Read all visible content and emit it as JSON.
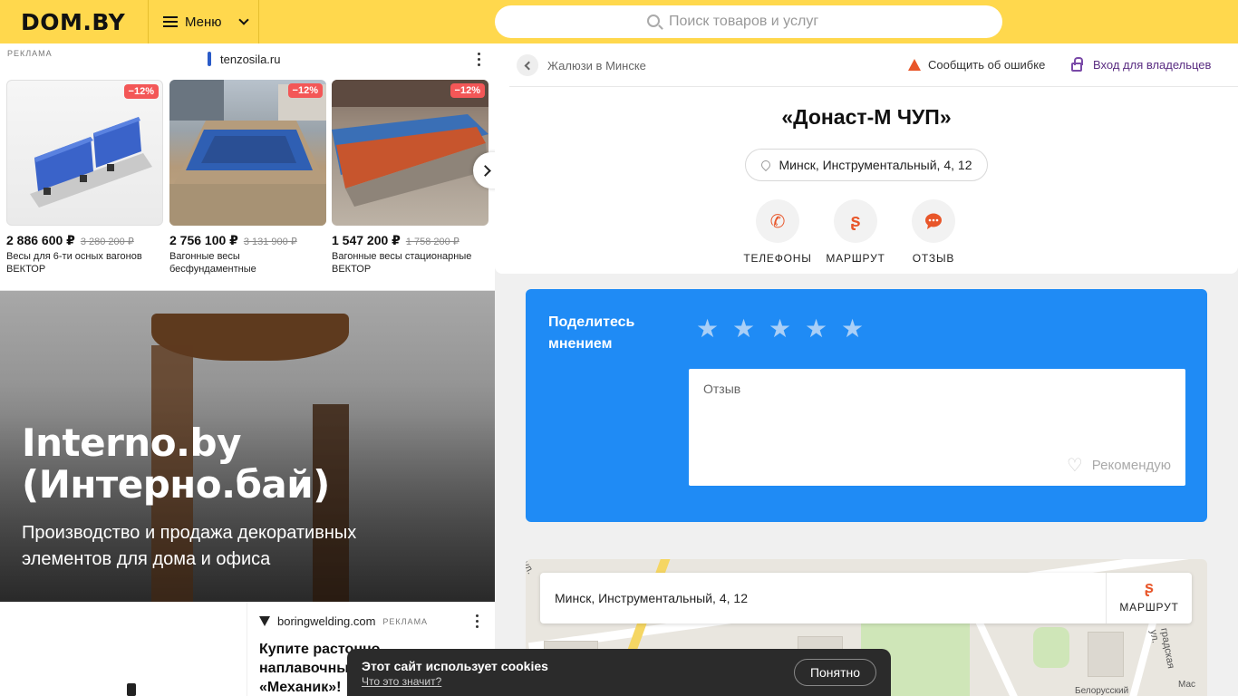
{
  "header": {
    "logo": "DOM.BY",
    "menu_label": "Меню",
    "search_placeholder": "Поиск товаров и услуг"
  },
  "ad_top": {
    "label": "РЕКЛАМА",
    "domain": "tenzosila.ru",
    "products": [
      {
        "discount": "−12%",
        "price": "2 886 600 ₽",
        "old_price": "3 280 200 ₽",
        "name": "Весы для 6-ти осных вагонов ВЕКТОР"
      },
      {
        "discount": "−12%",
        "price": "2 756 100 ₽",
        "old_price": "3 131 900 ₽",
        "name": "Вагонные весы бесфундаментные"
      },
      {
        "discount": "−12%",
        "price": "1 547 200 ₽",
        "old_price": "1 758 200 ₽",
        "name": "Вагонные весы стационарные ВЕКТОР"
      }
    ]
  },
  "banner": {
    "title": "Interno.by (Интерно.бай)",
    "subtitle": "Производство и продажа декоративных элементов для дома и офиса"
  },
  "ad_bottom": {
    "domain": "boringwelding.com",
    "label": "РЕКЛАМА",
    "title": "Купите растонно-наплавочный «Механик»!"
  },
  "company": {
    "breadcrumb": "Жалюзи в Минске",
    "report_error": "Сообщить об ошибке",
    "owner_login": "Вход для владельцев",
    "title": "«Донаст-М ЧУП»",
    "address": "Минск, Инструментальный, 4, 12",
    "actions": [
      {
        "icon": "phone-icon",
        "glyph": "✆",
        "label": "ТЕЛЕФОНЫ"
      },
      {
        "icon": "route-icon",
        "glyph": "ʂ",
        "label": "МАРШРУТ"
      },
      {
        "icon": "chat-icon",
        "glyph": "●",
        "label": "ОТЗЫВ"
      }
    ]
  },
  "review": {
    "heading": "Поделитесь мнением",
    "placeholder": "Отзыв",
    "recommend": "Рекомендую",
    "rating": 0,
    "max_rating": 5
  },
  "map": {
    "address": "Минск, Инструментальный, 4, 12",
    "route_label": "МАРШРУТ",
    "street_left": "ул.",
    "street_right": "градская ул.",
    "poi": "Белорусский",
    "mac": "Мас"
  },
  "cookie": {
    "text": "Этот сайт использует cookies",
    "link": "Что это значит?",
    "button": "Понятно"
  },
  "colors": {
    "header": "#ffd84d",
    "accent_blue": "#1f8bf5",
    "accent_orange": "#e8562a",
    "badge_red": "#f35757",
    "owner_link": "#5a2d82"
  }
}
